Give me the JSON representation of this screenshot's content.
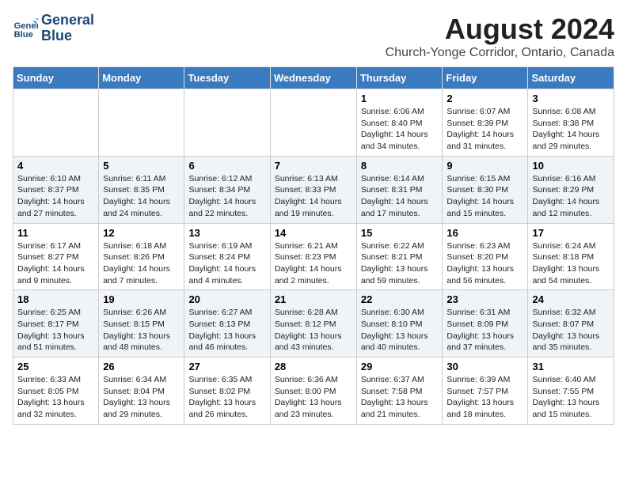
{
  "logo": {
    "line1": "General",
    "line2": "Blue"
  },
  "title": "August 2024",
  "subtitle": "Church-Yonge Corridor, Ontario, Canada",
  "headers": [
    "Sunday",
    "Monday",
    "Tuesday",
    "Wednesday",
    "Thursday",
    "Friday",
    "Saturday"
  ],
  "weeks": [
    [
      {
        "num": "",
        "info": ""
      },
      {
        "num": "",
        "info": ""
      },
      {
        "num": "",
        "info": ""
      },
      {
        "num": "",
        "info": ""
      },
      {
        "num": "1",
        "info": "Sunrise: 6:06 AM\nSunset: 8:40 PM\nDaylight: 14 hours\nand 34 minutes."
      },
      {
        "num": "2",
        "info": "Sunrise: 6:07 AM\nSunset: 8:39 PM\nDaylight: 14 hours\nand 31 minutes."
      },
      {
        "num": "3",
        "info": "Sunrise: 6:08 AM\nSunset: 8:38 PM\nDaylight: 14 hours\nand 29 minutes."
      }
    ],
    [
      {
        "num": "4",
        "info": "Sunrise: 6:10 AM\nSunset: 8:37 PM\nDaylight: 14 hours\nand 27 minutes."
      },
      {
        "num": "5",
        "info": "Sunrise: 6:11 AM\nSunset: 8:35 PM\nDaylight: 14 hours\nand 24 minutes."
      },
      {
        "num": "6",
        "info": "Sunrise: 6:12 AM\nSunset: 8:34 PM\nDaylight: 14 hours\nand 22 minutes."
      },
      {
        "num": "7",
        "info": "Sunrise: 6:13 AM\nSunset: 8:33 PM\nDaylight: 14 hours\nand 19 minutes."
      },
      {
        "num": "8",
        "info": "Sunrise: 6:14 AM\nSunset: 8:31 PM\nDaylight: 14 hours\nand 17 minutes."
      },
      {
        "num": "9",
        "info": "Sunrise: 6:15 AM\nSunset: 8:30 PM\nDaylight: 14 hours\nand 15 minutes."
      },
      {
        "num": "10",
        "info": "Sunrise: 6:16 AM\nSunset: 8:29 PM\nDaylight: 14 hours\nand 12 minutes."
      }
    ],
    [
      {
        "num": "11",
        "info": "Sunrise: 6:17 AM\nSunset: 8:27 PM\nDaylight: 14 hours\nand 9 minutes."
      },
      {
        "num": "12",
        "info": "Sunrise: 6:18 AM\nSunset: 8:26 PM\nDaylight: 14 hours\nand 7 minutes."
      },
      {
        "num": "13",
        "info": "Sunrise: 6:19 AM\nSunset: 8:24 PM\nDaylight: 14 hours\nand 4 minutes."
      },
      {
        "num": "14",
        "info": "Sunrise: 6:21 AM\nSunset: 8:23 PM\nDaylight: 14 hours\nand 2 minutes."
      },
      {
        "num": "15",
        "info": "Sunrise: 6:22 AM\nSunset: 8:21 PM\nDaylight: 13 hours\nand 59 minutes."
      },
      {
        "num": "16",
        "info": "Sunrise: 6:23 AM\nSunset: 8:20 PM\nDaylight: 13 hours\nand 56 minutes."
      },
      {
        "num": "17",
        "info": "Sunrise: 6:24 AM\nSunset: 8:18 PM\nDaylight: 13 hours\nand 54 minutes."
      }
    ],
    [
      {
        "num": "18",
        "info": "Sunrise: 6:25 AM\nSunset: 8:17 PM\nDaylight: 13 hours\nand 51 minutes."
      },
      {
        "num": "19",
        "info": "Sunrise: 6:26 AM\nSunset: 8:15 PM\nDaylight: 13 hours\nand 48 minutes."
      },
      {
        "num": "20",
        "info": "Sunrise: 6:27 AM\nSunset: 8:13 PM\nDaylight: 13 hours\nand 46 minutes."
      },
      {
        "num": "21",
        "info": "Sunrise: 6:28 AM\nSunset: 8:12 PM\nDaylight: 13 hours\nand 43 minutes."
      },
      {
        "num": "22",
        "info": "Sunrise: 6:30 AM\nSunset: 8:10 PM\nDaylight: 13 hours\nand 40 minutes."
      },
      {
        "num": "23",
        "info": "Sunrise: 6:31 AM\nSunset: 8:09 PM\nDaylight: 13 hours\nand 37 minutes."
      },
      {
        "num": "24",
        "info": "Sunrise: 6:32 AM\nSunset: 8:07 PM\nDaylight: 13 hours\nand 35 minutes."
      }
    ],
    [
      {
        "num": "25",
        "info": "Sunrise: 6:33 AM\nSunset: 8:05 PM\nDaylight: 13 hours\nand 32 minutes."
      },
      {
        "num": "26",
        "info": "Sunrise: 6:34 AM\nSunset: 8:04 PM\nDaylight: 13 hours\nand 29 minutes."
      },
      {
        "num": "27",
        "info": "Sunrise: 6:35 AM\nSunset: 8:02 PM\nDaylight: 13 hours\nand 26 minutes."
      },
      {
        "num": "28",
        "info": "Sunrise: 6:36 AM\nSunset: 8:00 PM\nDaylight: 13 hours\nand 23 minutes."
      },
      {
        "num": "29",
        "info": "Sunrise: 6:37 AM\nSunset: 7:58 PM\nDaylight: 13 hours\nand 21 minutes."
      },
      {
        "num": "30",
        "info": "Sunrise: 6:39 AM\nSunset: 7:57 PM\nDaylight: 13 hours\nand 18 minutes."
      },
      {
        "num": "31",
        "info": "Sunrise: 6:40 AM\nSunset: 7:55 PM\nDaylight: 13 hours\nand 15 minutes."
      }
    ]
  ]
}
